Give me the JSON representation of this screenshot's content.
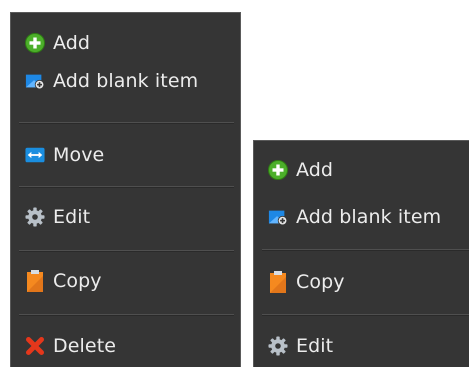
{
  "menu_left": {
    "items": [
      {
        "label": "Add",
        "icon": "add-icon"
      },
      {
        "label": "Add blank item",
        "icon": "add-blank-item-icon"
      },
      {
        "label": "Move",
        "icon": "move-icon"
      },
      {
        "label": "Edit",
        "icon": "gear-icon"
      },
      {
        "label": "Copy",
        "icon": "clipboard-icon"
      },
      {
        "label": "Delete",
        "icon": "delete-icon"
      }
    ]
  },
  "menu_right": {
    "items": [
      {
        "label": "Add",
        "icon": "add-icon"
      },
      {
        "label": "Add blank item",
        "icon": "add-blank-item-icon"
      },
      {
        "label": "Copy",
        "icon": "clipboard-icon"
      },
      {
        "label": "Edit",
        "icon": "gear-icon"
      }
    ]
  },
  "colors": {
    "menu_background": "#353535",
    "text": "#ececec",
    "add_green": "#4caf2a",
    "blank_blue": "#1e88e5",
    "move_blue": "#1a8ee0",
    "gear_grey": "#b8c0c8",
    "clipboard_orange": "#f5891f",
    "delete_red": "#e5371b"
  }
}
